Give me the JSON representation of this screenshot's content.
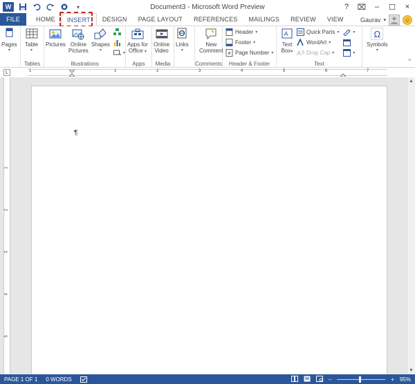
{
  "window": {
    "title": "Document3 - Microsoft Word Preview",
    "logo_text": "W",
    "controls": {
      "help": "?",
      "restore_ribbon": "⌧",
      "minimize": "–",
      "maximize": "☐",
      "close": "×"
    }
  },
  "tabs": [
    {
      "label": "FILE"
    },
    {
      "label": "HOME"
    },
    {
      "label": "INSERT",
      "active": true
    },
    {
      "label": "DESIGN"
    },
    {
      "label": "PAGE LAYOUT"
    },
    {
      "label": "REFERENCES"
    },
    {
      "label": "MAILINGS"
    },
    {
      "label": "REVIEW"
    },
    {
      "label": "VIEW"
    }
  ],
  "user": {
    "name": "Gaurav",
    "caret": "▾"
  },
  "ribbon": {
    "pages": {
      "label": "Pages",
      "group": ""
    },
    "tables": {
      "table_label": "Table",
      "group": "Tables"
    },
    "illustrations": {
      "pictures": "Pictures",
      "online_pictures_1": "Online",
      "online_pictures_2": "Pictures",
      "shapes": "Shapes",
      "group": "Illustrations"
    },
    "apps": {
      "apps_1": "Apps for",
      "apps_2": "Office",
      "group": "Apps"
    },
    "media": {
      "video_1": "Online",
      "video_2": "Video",
      "group": "Media"
    },
    "links": {
      "label": "Links",
      "group": ""
    },
    "comments": {
      "new_1": "New",
      "new_2": "Comment",
      "group": "Comments"
    },
    "header_footer": {
      "header": "Header",
      "footer": "Footer",
      "page_number": "Page Number",
      "group": "Header & Footer"
    },
    "text": {
      "text_box_1": "Text",
      "text_box_2": "Box",
      "quick_parts": "Quick Parts",
      "wordart": "WordArt",
      "drop_cap": "Drop Cap",
      "group": "Text"
    },
    "symbols": {
      "label": "Symbols",
      "omega": "Ω"
    }
  },
  "ruler": {
    "corner": "L",
    "marks": [
      "1",
      "1",
      "2",
      "3",
      "4",
      "5",
      "6",
      "7"
    ],
    "vmarks": [
      "1",
      "2",
      "3",
      "4",
      "5"
    ]
  },
  "document": {
    "pilcrow": "¶"
  },
  "status": {
    "page": "PAGE 1 OF 1",
    "words": "0 WORDS",
    "zoom": "95%",
    "zoom_value": 0.95,
    "zoom_minus": "–",
    "zoom_plus": "+"
  },
  "colors": {
    "accent": "#2b579a",
    "highlight": "#c62828"
  }
}
